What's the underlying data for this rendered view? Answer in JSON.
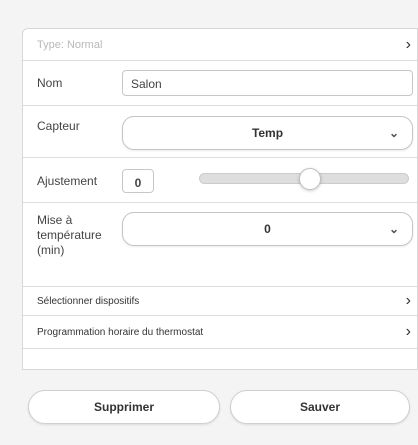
{
  "form": {
    "type_label": "Type: Normal",
    "nom": {
      "label": "Nom",
      "value": "Salon"
    },
    "capteur": {
      "label": "Capteur",
      "value": "Temp"
    },
    "ajustement": {
      "label": "Ajustement",
      "value": "0",
      "slider_fraction": 0.53
    },
    "mise": {
      "label_lines": [
        "Mise à",
        "température",
        "(min)"
      ],
      "value": "0"
    },
    "links": {
      "select_devices": "Sélectionner dispositifs",
      "schedule": "Programmation horaire du thermostat"
    }
  },
  "buttons": {
    "delete": "Supprimer",
    "save": "Sauver"
  },
  "icons": {
    "chevron_right": "›",
    "chevron_down": "⌄"
  },
  "colors": {
    "background": "#f4f4f4",
    "panel": "#ffffff",
    "border": "#d8d8d8"
  }
}
